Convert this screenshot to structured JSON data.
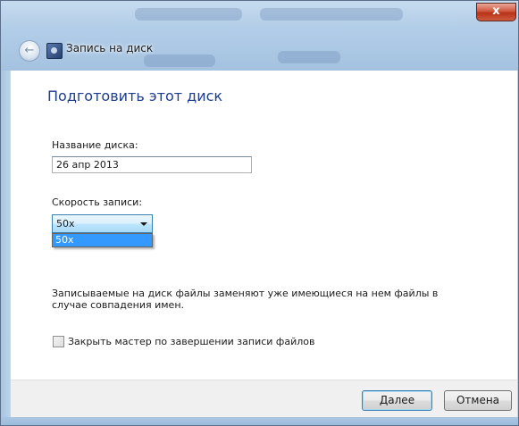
{
  "window": {
    "title": "Запись на диск",
    "close_label": "x"
  },
  "main": {
    "heading": "Подготовить этот диск",
    "disc_name_label": "Название диска:",
    "disc_name_value": "26 апр 2013",
    "speed_label": "Скорость записи:",
    "speed_selected": "50x",
    "speed_options": [
      "50x"
    ],
    "note": "Записываемые на диск файлы заменяют уже имеющиеся на нем файлы в случае совпадения имен.",
    "close_wizard_checkbox": {
      "label": "Закрыть мастер по завершении записи файлов",
      "checked": false
    }
  },
  "footer": {
    "next_label": "Далее",
    "cancel_label": "Отмена"
  },
  "colors": {
    "heading": "#1e3d8c",
    "selection": "#3399ff",
    "titlebar": "#b2cde8"
  }
}
